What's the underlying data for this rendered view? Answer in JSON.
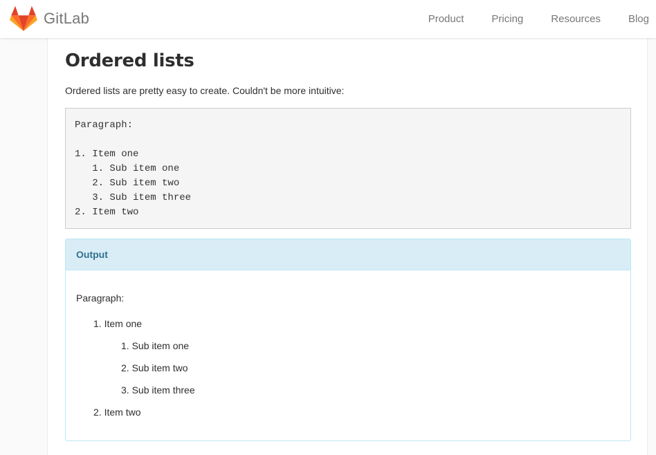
{
  "header": {
    "logo_text": "GitLab",
    "logo_icon": "gitlab-tanuki-icon",
    "nav": [
      "Product",
      "Pricing",
      "Resources",
      "Blog"
    ]
  },
  "article": {
    "title": "Ordered lists",
    "intro": "Ordered lists are pretty easy to create. Couldn't be more intuitive:",
    "code_lines": [
      "Paragraph:",
      "",
      "1. Item one",
      "   1. Sub item one",
      "   2. Sub item two",
      "   3. Sub item three",
      "2. Item two"
    ],
    "output": {
      "heading": "Output",
      "paragraph": "Paragraph:",
      "items": [
        {
          "number": "1.",
          "text": "Item one"
        },
        {
          "number": "2.",
          "text": "Item two"
        }
      ],
      "sub_items": [
        {
          "number": "1.",
          "text": "Sub item one"
        },
        {
          "number": "2.",
          "text": "Sub item two"
        },
        {
          "number": "3.",
          "text": "Sub item three"
        }
      ]
    }
  },
  "colors": {
    "logo_orange": "#fc6d26",
    "logo_red": "#e24329",
    "logo_light": "#fca326",
    "panel_heading_bg": "#d9edf7",
    "panel_heading_text": "#31708f",
    "panel_border": "#bce8f1"
  }
}
